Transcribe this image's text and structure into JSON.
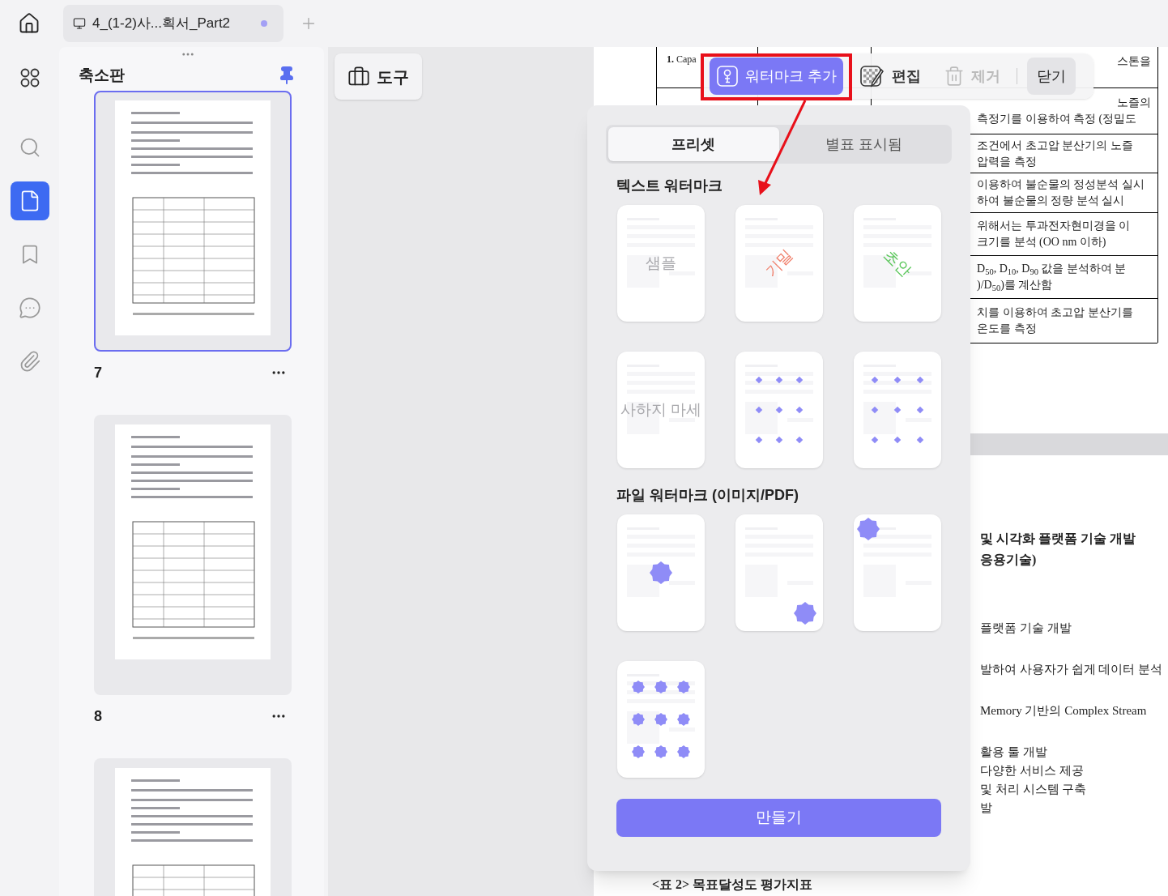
{
  "tab": {
    "title": "4_(1-2)사...획서_Part2",
    "modified": true
  },
  "rail": [
    {
      "selected": false
    },
    {
      "selected": false
    },
    {
      "selected": true
    },
    {
      "selected": false
    },
    {
      "selected": false
    },
    {
      "selected": false
    }
  ],
  "sidebar": {
    "title": "축소판",
    "pinned": true,
    "thumbnails": [
      {
        "page": "7",
        "selected": true
      },
      {
        "page": "8",
        "selected": false
      },
      {
        "selected": false
      }
    ]
  },
  "tools_button": "도구",
  "toolbar": {
    "tools": [
      {
        "label": "워터마크 추가",
        "selected": true,
        "disabled": false
      },
      {
        "label": "편집",
        "selected": false,
        "disabled": false
      },
      {
        "label": "제거",
        "selected": false,
        "disabled": true
      }
    ],
    "close": "닫기"
  },
  "watermark_panel": {
    "tabs": [
      {
        "label": "프리셋",
        "selected": true
      },
      {
        "label": "별표 표시됨",
        "selected": false
      }
    ],
    "sections": [
      {
        "title": "텍스트 워터마크",
        "templates": [
          {
            "kind": "text",
            "text": "샘플",
            "color": "#a9a9ad"
          },
          {
            "kind": "rising",
            "text": "기밀",
            "color": "#f0826e"
          },
          {
            "kind": "falling",
            "text": "초안",
            "color": "#5cc75c"
          },
          {
            "kind": "text",
            "text": "사하지 마세",
            "color": "#a9a9ad"
          },
          {
            "kind": "tiled"
          },
          {
            "kind": "tiled"
          }
        ]
      },
      {
        "title": "파일 워터마크 (이미지/PDF)",
        "templates": [
          {
            "kind": "centered"
          },
          {
            "kind": "corner"
          },
          {
            "kind": "topleft"
          },
          {
            "kind": "tiledimage"
          }
        ]
      }
    ],
    "create_button": "만들기"
  },
  "document": {
    "first_cell": "**1.** Capa",
    "rows": [
      [
        "스톤을"
      ],
      [
        "노즐의",
        "측정기를 이용하여 측정 (정밀도"
      ],
      [
        "조건에서 초고압 분산기의 노즐",
        "압력을 측정"
      ],
      [
        "이용하여 불순물의 정성분석 실시",
        "하여 불순물의 정량 분석 실시"
      ],
      [
        "위해서는 투과전자현미경을 이",
        "크기를 분석 (OO nm 이하)"
      ],
      [
        "D$_{50}$, D$_{10}$, D$_{90}$ 값을 분석하여 분",
        ")/D$_{50}$)를 계산함"
      ],
      [
        "치를 이용하여 초고압 분산기를",
        "온도를 측정"
      ]
    ],
    "heading": [
      "및 시각화 플랫폼 기술 개발",
      "응용기술)"
    ],
    "paragraphs": [
      [
        "플랫폼 기술 개발"
      ],
      [
        "발하여 사용자가 쉽게 데이터 분석"
      ],
      [
        "Memory 기반의 Complex Stream"
      ],
      [
        "활용 툴 개발",
        "다양한 서비스 제공",
        "및 처리 시스템 구축",
        "발"
      ]
    ],
    "caption": "<표 2> 목표달성도 평가지표"
  }
}
